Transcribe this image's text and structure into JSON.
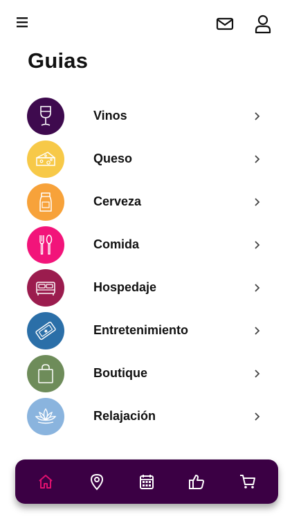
{
  "header": {
    "title": "Guias",
    "icons": [
      "hamburger-menu-icon",
      "mail-icon",
      "user-icon"
    ]
  },
  "categories": [
    {
      "label": "Vinos",
      "icon": "wine-glass-icon",
      "color": "#3e0a4e"
    },
    {
      "label": "Queso",
      "icon": "cheese-icon",
      "color": "#f7c948"
    },
    {
      "label": "Cerveza",
      "icon": "beer-icon",
      "color": "#f7a23a"
    },
    {
      "label": "Comida",
      "icon": "cutlery-icon",
      "color": "#f2147a"
    },
    {
      "label": "Hospedaje",
      "icon": "bed-icon",
      "color": "#9b1c4e"
    },
    {
      "label": "Entretenimiento",
      "icon": "ticket-icon",
      "color": "#2b6fa8"
    },
    {
      "label": "Boutique",
      "icon": "shopping-bag-icon",
      "color": "#6e8c5a"
    },
    {
      "label": "Relajación",
      "icon": "lotus-icon",
      "color": "#8ab4de"
    }
  ],
  "bottom_nav": {
    "items": [
      "home-icon",
      "location-pin-icon",
      "calendar-icon",
      "thumbs-up-icon",
      "cart-icon"
    ],
    "active": "home-icon",
    "background": "#3b0044",
    "active_color": "#e0106f",
    "inactive_color": "#ffffff"
  }
}
